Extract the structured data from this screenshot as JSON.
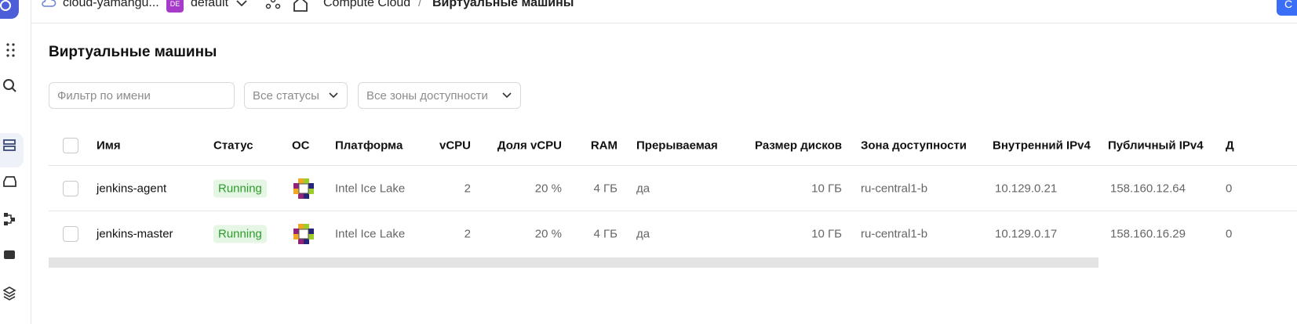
{
  "topbar": {
    "cloud_name": "cloud-yamangu...",
    "folder_badge": "DE",
    "folder_name": "default",
    "breadcrumb_service": "Compute Cloud",
    "breadcrumb_sep": "/",
    "breadcrumb_page": "Виртуальные машины",
    "create_button": "С"
  },
  "page": {
    "title": "Виртуальные машины"
  },
  "filters": {
    "name_placeholder": "Фильтр по имени",
    "status_select": "Все статусы",
    "zone_select": "Все зоны доступности"
  },
  "table": {
    "headers": {
      "name": "Имя",
      "status": "Статус",
      "os": "ОС",
      "platform": "Платформа",
      "vcpu": "vCPU",
      "vcpu_share": "Доля vCPU",
      "ram": "RAM",
      "preemptible": "Прерываемая",
      "disk_size": "Размер дисков",
      "zone": "Зона доступности",
      "internal_ip": "Внутренний IPv4",
      "public_ip": "Публичный IPv4",
      "extra": "Д"
    },
    "rows": [
      {
        "name": "jenkins-agent",
        "status": "Running",
        "os_icon": "centos-icon",
        "platform": "Intel Ice Lake",
        "vcpu": "2",
        "vcpu_share": "20 %",
        "ram": "4 ГБ",
        "preemptible": "да",
        "disk_size": "10 ГБ",
        "zone": "ru-central1-b",
        "internal_ip": "10.129.0.21",
        "public_ip": "158.160.12.64",
        "extra": "0"
      },
      {
        "name": "jenkins-master",
        "status": "Running",
        "os_icon": "centos-icon",
        "platform": "Intel Ice Lake",
        "vcpu": "2",
        "vcpu_share": "20 %",
        "ram": "4 ГБ",
        "preemptible": "да",
        "disk_size": "10 ГБ",
        "zone": "ru-central1-b",
        "internal_ip": "10.129.0.17",
        "public_ip": "158.160.16.29",
        "extra": "0"
      }
    ]
  },
  "colors": {
    "accent": "#3b6ef6",
    "status_running_bg": "#e6f6e4",
    "status_running_text": "#2a9d2a",
    "folder_badge": "#a73bc9"
  }
}
